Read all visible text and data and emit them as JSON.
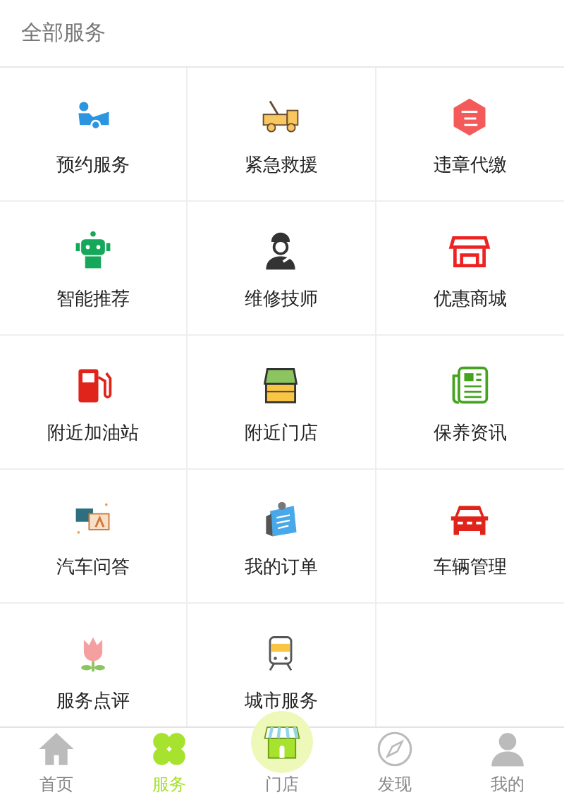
{
  "header": {
    "title": "全部服务"
  },
  "services": [
    {
      "label": "预约服务"
    },
    {
      "label": "紧急救援"
    },
    {
      "label": "违章代缴"
    },
    {
      "label": "智能推荐"
    },
    {
      "label": "维修技师"
    },
    {
      "label": "优惠商城"
    },
    {
      "label": "附近加油站"
    },
    {
      "label": "附近门店"
    },
    {
      "label": "保养资讯"
    },
    {
      "label": "汽车问答"
    },
    {
      "label": "我的订单"
    },
    {
      "label": "车辆管理"
    },
    {
      "label": "服务点评"
    },
    {
      "label": "城市服务"
    }
  ],
  "tab_bar": [
    {
      "label": "首页",
      "selected": false,
      "raised": false
    },
    {
      "label": "服务",
      "selected": true,
      "raised": false
    },
    {
      "label": "门店",
      "selected": false,
      "raised": true
    },
    {
      "label": "发现",
      "selected": false,
      "raised": false
    },
    {
      "label": "我的",
      "selected": false,
      "raised": false
    }
  ]
}
